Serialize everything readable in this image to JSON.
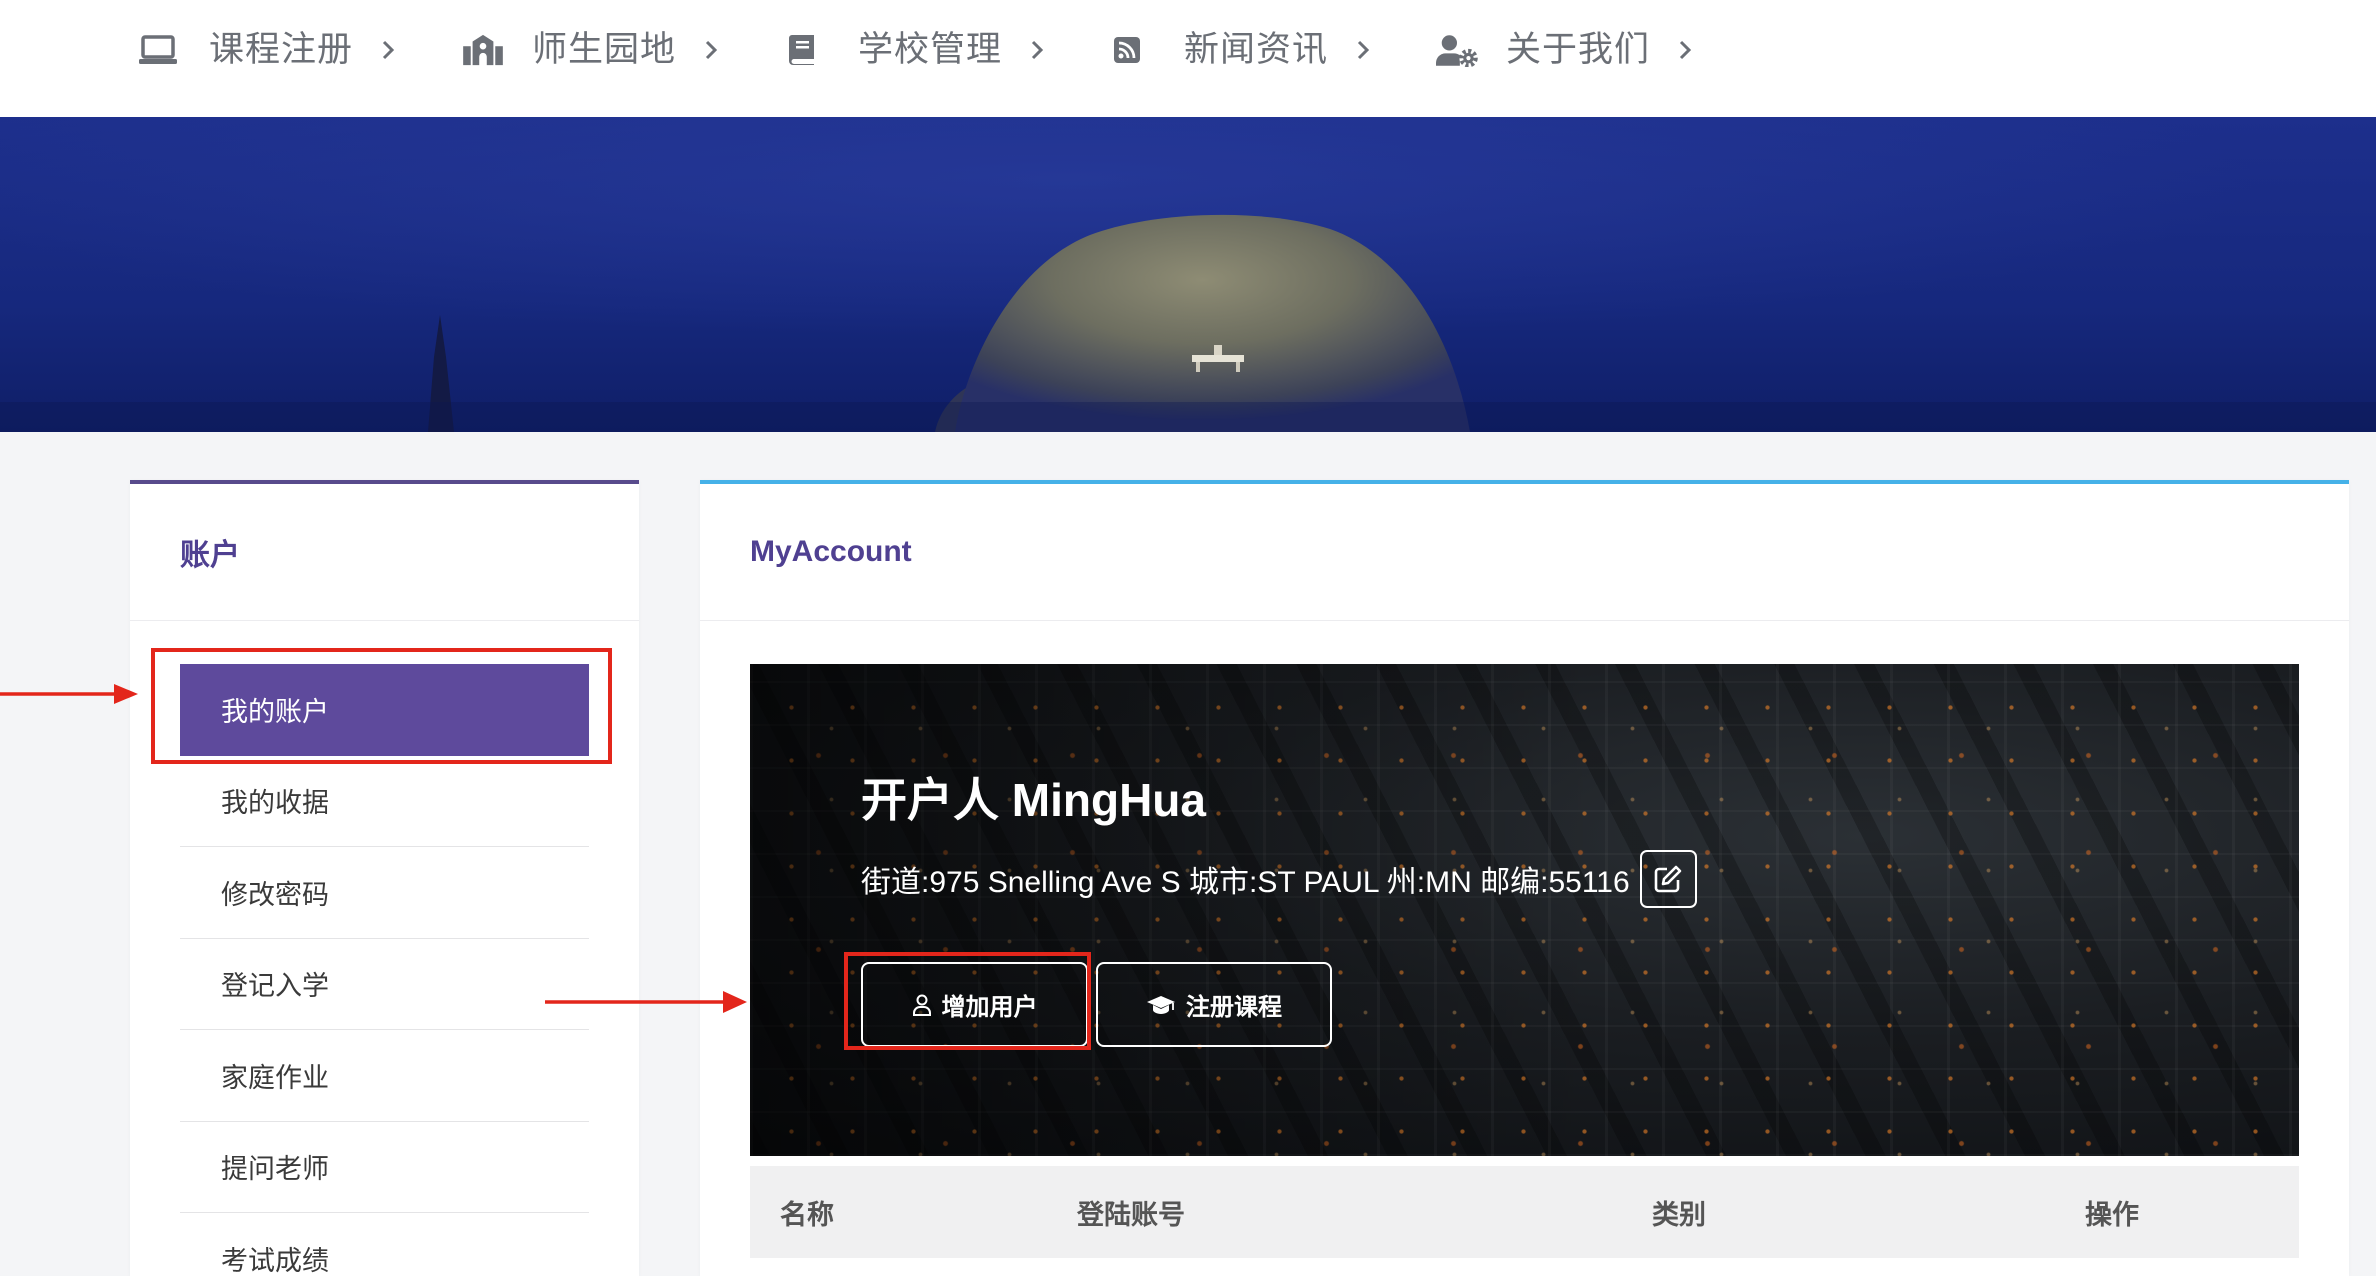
{
  "nav": {
    "items": [
      {
        "label": "课程注册",
        "icon": "laptop-icon"
      },
      {
        "label": "师生园地",
        "icon": "school-icon"
      },
      {
        "label": "学校管理",
        "icon": "book-icon"
      },
      {
        "label": "新闻资讯",
        "icon": "rss-icon"
      },
      {
        "label": "关于我们",
        "icon": "user-cog-icon"
      }
    ],
    "chevron_icon": "chevron-right-icon"
  },
  "sidebar": {
    "title": "账户",
    "items": [
      {
        "label": "我的账户",
        "active": true
      },
      {
        "label": "我的收据",
        "active": false
      },
      {
        "label": "修改密码",
        "active": false
      },
      {
        "label": "登记入学",
        "active": false
      },
      {
        "label": "家庭作业",
        "active": false
      },
      {
        "label": "提问老师",
        "active": false
      },
      {
        "label": "考试成绩",
        "active": false
      }
    ]
  },
  "main": {
    "title": "MyAccount",
    "account": {
      "holder": "开户人 MingHua",
      "address": "街道:975 Snelling Ave S 城市:ST PAUL 州:MN 邮编:55116",
      "edit_icon": "edit-icon"
    },
    "buttons": {
      "add_user": {
        "label": "增加用户",
        "icon": "user-icon"
      },
      "register_course": {
        "label": "注册课程",
        "icon": "graduation-cap-icon"
      }
    },
    "table": {
      "headers": [
        "名称",
        "登陆账号",
        "类别",
        "操作"
      ]
    }
  },
  "colors": {
    "accent": "#5e4a9c",
    "title": "#4f4091",
    "sidebar_border": "#584b8c",
    "main_border": "#45b1e8",
    "annotation": "#e3261b",
    "nav_text": "#6b6f76"
  }
}
